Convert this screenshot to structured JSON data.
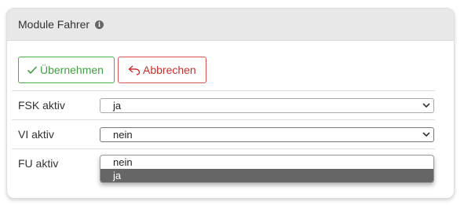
{
  "panel": {
    "title": "Module Fahrer",
    "info_icon": "info-circle-icon"
  },
  "toolbar": {
    "apply_label": "Übernehmen",
    "apply_icon": "checkmark-icon",
    "apply_color": "#449d44",
    "cancel_label": "Abbrechen",
    "cancel_icon": "undo-arrow-icon",
    "cancel_color": "#c9302c"
  },
  "rows": [
    {
      "label": "FSK aktiv",
      "value": "ja"
    },
    {
      "label": "VI aktiv",
      "value": "nein"
    },
    {
      "label": "FU aktiv",
      "value": ""
    }
  ],
  "dropdown": {
    "options": [
      "nein",
      "ja"
    ],
    "highlighted": "ja"
  }
}
